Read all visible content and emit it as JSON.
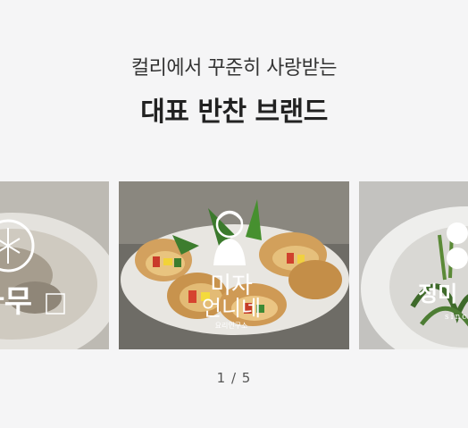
{
  "header": {
    "subtitle": "컬리에서 꾸준히 사랑받는",
    "title": "대표 반찬 브랜드"
  },
  "slides": [
    {
      "logo_text": "나무",
      "position": "previous"
    },
    {
      "logo_text_line1": "미자",
      "logo_text_line2": "언니네",
      "logo_caption": "요리연구소",
      "position": "current"
    },
    {
      "logo_text": "정미",
      "logo_caption": "since",
      "position": "next"
    }
  ],
  "pagination": {
    "current": 1,
    "total": 5,
    "label": "1 / 5"
  },
  "colors": {
    "background": "#f5f5f6",
    "title": "#222222",
    "subtitle": "#333333",
    "pager": "#555555"
  }
}
